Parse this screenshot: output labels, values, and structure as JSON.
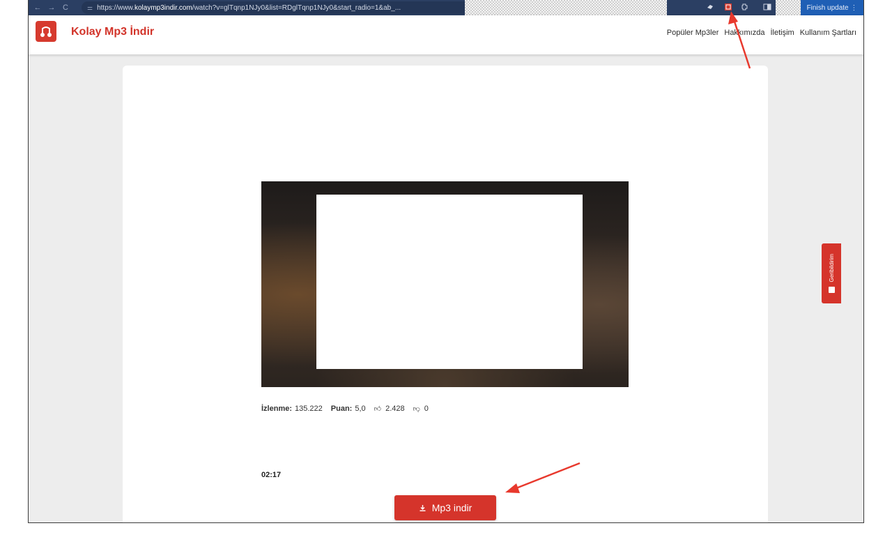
{
  "browser": {
    "url_prefix": "https://www.",
    "url_domain": "kolaymp3indir.com",
    "url_path": "/watch?v=glTqnp1NJy0&list=RDglTqnp1NJy0&start_radio=1&ab_...",
    "finish_update_label": "Finish update"
  },
  "site": {
    "brand": "Kolay Mp3 İndir",
    "nav": [
      "Popüler Mp3ler",
      "Hakkımızda",
      "İletişim",
      "Kullanım Şartları"
    ]
  },
  "video": {
    "stats": {
      "views_label": "İzlenme:",
      "views_value": "135.222",
      "rating_label": "Puan:",
      "rating_value": "5,0",
      "likes": "2.428",
      "dislikes": "0"
    },
    "duration": "02:17"
  },
  "download_button": {
    "label": "Mp3 indir"
  },
  "feedback_tab": {
    "label": "Geribildirim"
  },
  "colors": {
    "brand_red": "#d5342b",
    "toolbar": "#2b3f63",
    "annotation": "#e8392d"
  },
  "icons": [
    "back-icon",
    "forward-icon",
    "reload-icon",
    "tune-icon",
    "star-icon",
    "extension-icon",
    "sidepanel-icon",
    "like-icon",
    "dislike-icon",
    "download-icon",
    "feedback-icon"
  ]
}
